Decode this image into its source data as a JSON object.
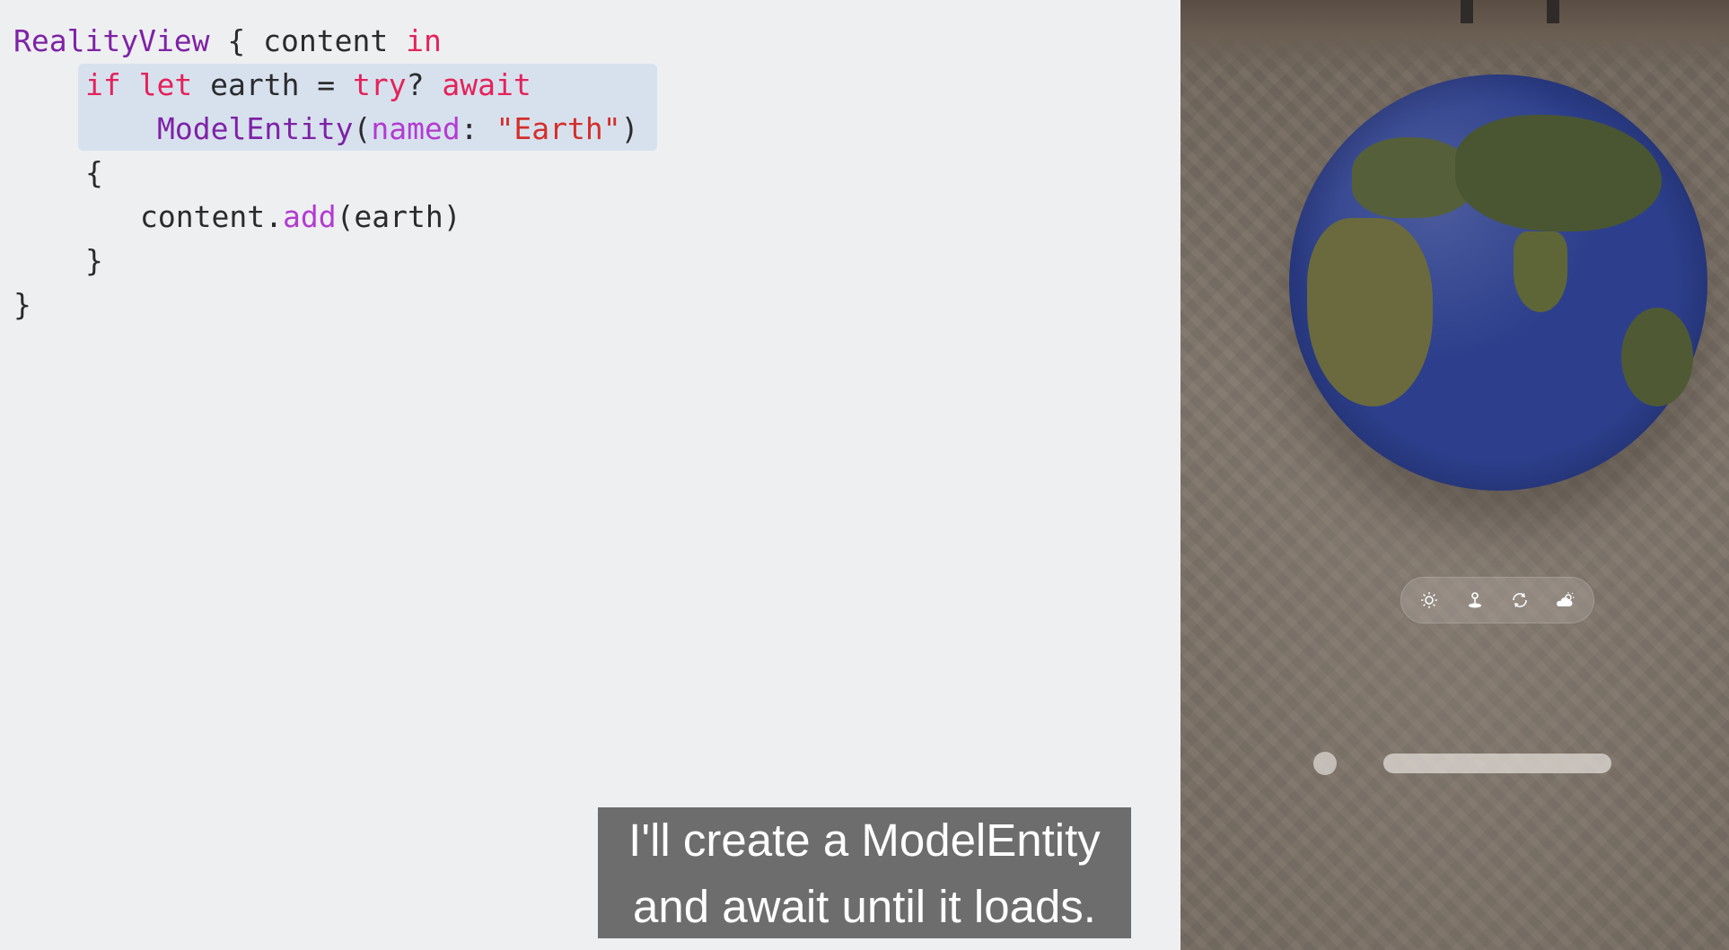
{
  "code": {
    "line1": {
      "type": "RealityView",
      "text1": " { content ",
      "kw": "in"
    },
    "line2": {
      "kw1": "if",
      "sp1": " ",
      "kw2": "let",
      "text1": " earth = ",
      "kw3": "try",
      "text2": "? ",
      "kw4": "await"
    },
    "line3": {
      "type": "ModelEntity",
      "text1": "(",
      "param": "named",
      "text2": ": ",
      "str": "\"Earth\"",
      "text3": ")"
    },
    "line4": {
      "text": "{"
    },
    "line5": {
      "text1": "content.",
      "fn": "add",
      "text2": "(earth)"
    },
    "line6": {
      "text": "}"
    },
    "line7": {
      "text": "}"
    }
  },
  "caption": {
    "line1": "I'll create a ModelEntity",
    "line2": "and await until it loads."
  },
  "preview": {
    "model_name": "earth-globe",
    "ornament": {
      "buttons": [
        "sun-icon",
        "pin-icon",
        "rotate-icon",
        "cloud-sun-icon"
      ]
    }
  },
  "colors": {
    "keyword": "#e4225a",
    "type": "#7e22a6",
    "param": "#b23bd1",
    "string": "#d42f2a",
    "highlight": "#d7e1ee",
    "caption_bg": "#626262"
  }
}
